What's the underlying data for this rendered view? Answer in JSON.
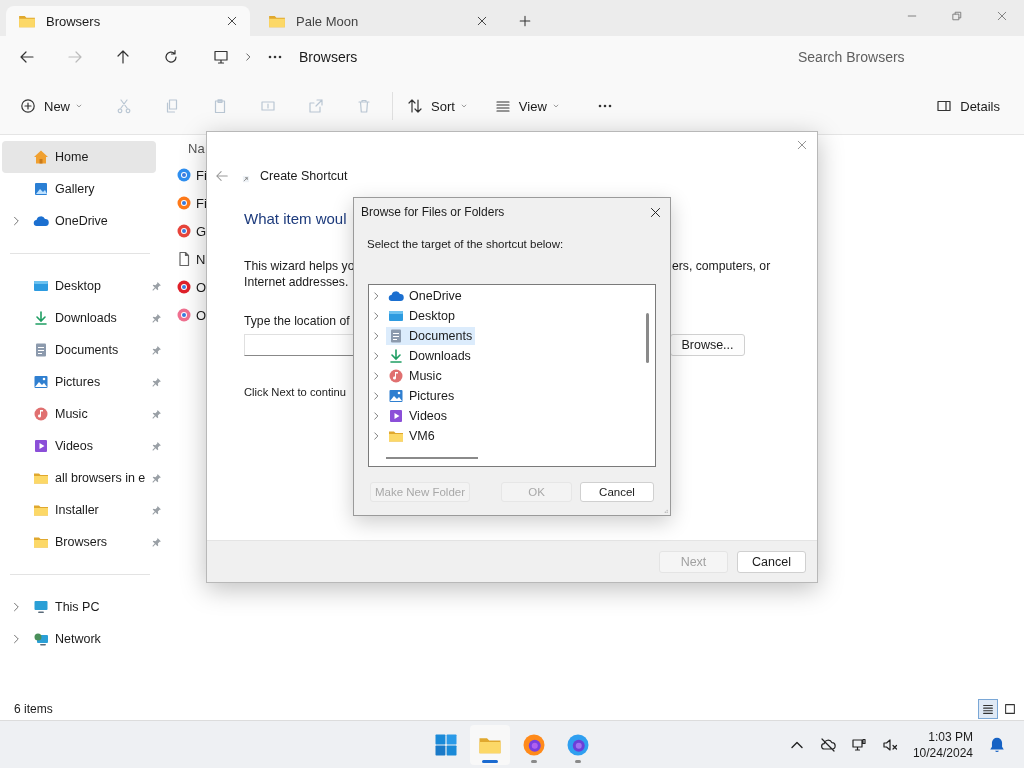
{
  "tabs": [
    {
      "label": "Browsers",
      "selected": true
    },
    {
      "label": "Pale Moon",
      "selected": false
    }
  ],
  "nav": [
    {
      "kind": "back",
      "disabled": false
    },
    {
      "kind": "forward",
      "disabled": true
    },
    {
      "kind": "up",
      "disabled": false
    },
    {
      "kind": "refresh",
      "disabled": false
    }
  ],
  "address": {
    "location": "Browsers"
  },
  "search": {
    "placeholder": "Search Browsers"
  },
  "toolbar": [
    {
      "kind": "new",
      "label": "New",
      "disabled": false
    },
    {
      "kind": "cut",
      "disabled": true
    },
    {
      "kind": "copy",
      "disabled": true
    },
    {
      "kind": "paste",
      "disabled": true
    },
    {
      "kind": "rename",
      "disabled": true
    },
    {
      "kind": "share",
      "disabled": true
    },
    {
      "kind": "delete",
      "disabled": true
    },
    {
      "kind": "sort",
      "label": "Sort",
      "disabled": false
    },
    {
      "kind": "view",
      "label": "View",
      "disabled": false
    },
    {
      "kind": "more",
      "disabled": false
    }
  ],
  "details_button": "Details",
  "sidebar": [
    [
      {
        "label": "Home",
        "kind": "home",
        "selected": true,
        "expandable": false,
        "pinned": false
      },
      {
        "label": "Gallery",
        "kind": "gallery",
        "selected": false,
        "expandable": false,
        "pinned": false
      },
      {
        "label": "OneDrive",
        "kind": "onedrive",
        "selected": false,
        "expandable": true,
        "pinned": false
      }
    ],
    [
      {
        "label": "Desktop",
        "kind": "desktop",
        "selected": false,
        "expandable": false,
        "pinned": true
      },
      {
        "label": "Downloads",
        "kind": "downloads",
        "selected": false,
        "expandable": false,
        "pinned": true
      },
      {
        "label": "Documents",
        "kind": "documents",
        "selected": false,
        "expandable": false,
        "pinned": true
      },
      {
        "label": "Pictures",
        "kind": "pictures",
        "selected": false,
        "expandable": false,
        "pinned": true
      },
      {
        "label": "Music",
        "kind": "music",
        "selected": false,
        "expandable": false,
        "pinned": true
      },
      {
        "label": "Videos",
        "kind": "videos",
        "selected": false,
        "expandable": false,
        "pinned": true
      },
      {
        "label": "all browsers in e",
        "kind": "folder",
        "selected": false,
        "expandable": false,
        "pinned": true
      },
      {
        "label": "Installer",
        "kind": "folder",
        "selected": false,
        "expandable": false,
        "pinned": true
      },
      {
        "label": "Browsers",
        "kind": "folder",
        "selected": false,
        "expandable": false,
        "pinned": true
      }
    ],
    [
      {
        "label": "This PC",
        "kind": "pc",
        "selected": false,
        "expandable": true,
        "pinned": false
      },
      {
        "label": "Network",
        "kind": "network",
        "selected": false,
        "expandable": true,
        "pinned": false
      }
    ]
  ],
  "file_list": {
    "column_1": "Na",
    "rows": [
      {
        "name": "Fi",
        "kind": "app",
        "color": "#2f8ff0"
      },
      {
        "name": "Fi",
        "kind": "app",
        "color": "#ff7a1a"
      },
      {
        "name": "G",
        "kind": "app",
        "color": "#e8453c"
      },
      {
        "name": "N",
        "kind": "file"
      },
      {
        "name": "O",
        "kind": "app",
        "color": "#e0202a"
      },
      {
        "name": "O",
        "kind": "app",
        "color": "#f07090"
      }
    ]
  },
  "status_bar": {
    "count": "6 items",
    "views": [
      {
        "kind": "details",
        "selected": true
      },
      {
        "kind": "tiles",
        "selected": false
      }
    ]
  },
  "wizard": {
    "title": "Create Shortcut",
    "heading": "What item woul",
    "intro_left": [
      "This wizard helps yo",
      "Internet addresses."
    ],
    "intro_right": "ers, computers, or",
    "location_label": "Type the location of",
    "browse_button": "Browse...",
    "continue_text": "Click Next to continu",
    "buttons": [
      {
        "label": "Next",
        "disabled": true
      },
      {
        "label": "Cancel",
        "disabled": false
      }
    ]
  },
  "browse_dialog": {
    "title": "Browse for Files or Folders",
    "prompt": "Select the target of the shortcut below:",
    "tree": [
      {
        "label": "OneDrive",
        "kind": "onedrive",
        "selected": false
      },
      {
        "label": "Desktop",
        "kind": "desktop",
        "selected": false
      },
      {
        "label": "Documents",
        "kind": "documents",
        "selected": true
      },
      {
        "label": "Downloads",
        "kind": "downloads",
        "selected": false
      },
      {
        "label": "Music",
        "kind": "music",
        "selected": false
      },
      {
        "label": "Pictures",
        "kind": "pictures",
        "selected": false
      },
      {
        "label": "Videos",
        "kind": "videos",
        "selected": false
      },
      {
        "label": "VM6",
        "kind": "folder",
        "selected": false
      }
    ],
    "buttons": [
      {
        "label": "Make New Folder",
        "disabled": true
      },
      {
        "label": "OK",
        "disabled": true
      },
      {
        "label": "Cancel",
        "disabled": false
      }
    ]
  },
  "taskbar": {
    "apps": [
      {
        "kind": "start",
        "open": false,
        "active": false
      },
      {
        "kind": "explorer",
        "open": true,
        "active": true
      },
      {
        "kind": "firefox",
        "open": true,
        "active": false
      },
      {
        "kind": "firefox-dev",
        "open": true,
        "active": false
      }
    ],
    "time": "1:03 PM",
    "date": "10/24/2024"
  }
}
